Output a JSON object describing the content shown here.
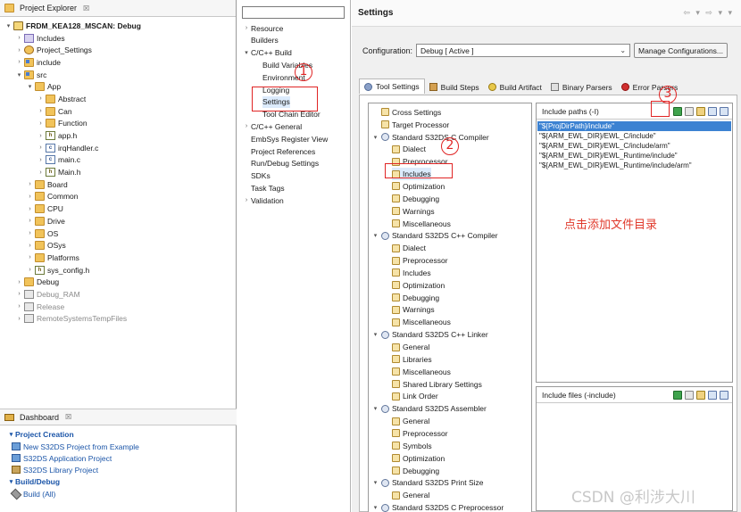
{
  "project_explorer": {
    "title": "Project Explorer",
    "close_glyph": "☒",
    "items": [
      {
        "depth": 0,
        "twisty": "▾",
        "icon": "project-icon",
        "label": "FRDM_KEA128_MSCAN: Debug",
        "bold": true
      },
      {
        "depth": 1,
        "twisty": "›",
        "icon": "includes-icon",
        "label": "Includes"
      },
      {
        "depth": 1,
        "twisty": "›",
        "icon": "settings-folder-icon",
        "label": "Project_Settings"
      },
      {
        "depth": 1,
        "twisty": "›",
        "icon": "source-folder-icon",
        "label": "include"
      },
      {
        "depth": 1,
        "twisty": "▾",
        "icon": "source-folder-icon",
        "label": "src"
      },
      {
        "depth": 2,
        "twisty": "▾",
        "icon": "folder-icon",
        "label": "App"
      },
      {
        "depth": 3,
        "twisty": "›",
        "icon": "folder-icon",
        "label": "Abstract"
      },
      {
        "depth": 3,
        "twisty": "›",
        "icon": "folder-icon",
        "label": "Can"
      },
      {
        "depth": 3,
        "twisty": "›",
        "icon": "folder-icon",
        "label": "Function"
      },
      {
        "depth": 3,
        "twisty": "›",
        "icon": "header-file-icon",
        "label": "app.h"
      },
      {
        "depth": 3,
        "twisty": "›",
        "icon": "c-file-icon",
        "label": "irqHandler.c"
      },
      {
        "depth": 3,
        "twisty": "›",
        "icon": "c-file-icon",
        "label": "main.c"
      },
      {
        "depth": 3,
        "twisty": "›",
        "icon": "header-file-icon",
        "label": "Main.h"
      },
      {
        "depth": 2,
        "twisty": "›",
        "icon": "folder-icon",
        "label": "Board"
      },
      {
        "depth": 2,
        "twisty": "›",
        "icon": "folder-icon",
        "label": "Common"
      },
      {
        "depth": 2,
        "twisty": "›",
        "icon": "folder-icon",
        "label": "CPU"
      },
      {
        "depth": 2,
        "twisty": "›",
        "icon": "folder-icon",
        "label": "Drive"
      },
      {
        "depth": 2,
        "twisty": "›",
        "icon": "folder-icon",
        "label": "OS"
      },
      {
        "depth": 2,
        "twisty": "›",
        "icon": "folder-icon",
        "label": "OSys"
      },
      {
        "depth": 2,
        "twisty": "›",
        "icon": "folder-icon",
        "label": "Platforms"
      },
      {
        "depth": 2,
        "twisty": "›",
        "icon": "header-file-icon",
        "label": "sys_config.h"
      },
      {
        "depth": 1,
        "twisty": "›",
        "icon": "folder-icon",
        "label": "Debug"
      },
      {
        "depth": 1,
        "twisty": "›",
        "icon": "binary-folder-icon",
        "label": "Debug_RAM",
        "grey": true
      },
      {
        "depth": 1,
        "twisty": "›",
        "icon": "binary-folder-icon",
        "label": "Release",
        "grey": true
      },
      {
        "depth": 1,
        "twisty": "›",
        "icon": "binary-folder-icon",
        "label": "RemoteSystemsTempFiles",
        "grey": true
      }
    ]
  },
  "dashboard": {
    "title": "Dashboard",
    "close_glyph": "☒",
    "sections": [
      {
        "title": "Project Creation",
        "items": [
          "New S32DS Project from Example",
          "S32DS Application Project",
          "S32DS Library Project"
        ]
      },
      {
        "title": "Build/Debug",
        "items": [
          "Build  (All)"
        ]
      }
    ]
  },
  "property_nav": {
    "filter_placeholder": "",
    "items": [
      {
        "depth": 0,
        "twisty": "›",
        "label": "Resource"
      },
      {
        "depth": 0,
        "twisty": "",
        "label": "Builders"
      },
      {
        "depth": 0,
        "twisty": "▾",
        "label": "C/C++ Build"
      },
      {
        "depth": 1,
        "twisty": "",
        "label": "Build Variables"
      },
      {
        "depth": 1,
        "twisty": "",
        "label": "Environment"
      },
      {
        "depth": 1,
        "twisty": "",
        "label": "Logging"
      },
      {
        "depth": 1,
        "twisty": "",
        "label": "Settings",
        "selected": true
      },
      {
        "depth": 1,
        "twisty": "",
        "label": "Tool Chain Editor"
      },
      {
        "depth": 0,
        "twisty": "›",
        "label": "C/C++ General"
      },
      {
        "depth": 0,
        "twisty": "",
        "label": "EmbSys Register View"
      },
      {
        "depth": 0,
        "twisty": "",
        "label": "Project References"
      },
      {
        "depth": 0,
        "twisty": "",
        "label": "Run/Debug Settings"
      },
      {
        "depth": 0,
        "twisty": "",
        "label": "SDKs"
      },
      {
        "depth": 0,
        "twisty": "",
        "label": "Task Tags"
      },
      {
        "depth": 0,
        "twisty": "›",
        "label": "Validation"
      }
    ]
  },
  "settings": {
    "title": "Settings",
    "nav_arrows": "⇦ ▾ ⇨ ▾ ▾",
    "configuration_label": "Configuration:",
    "configuration_value": "Debug  [ Active ]",
    "manage_button": "Manage Configurations...",
    "tabs": [
      {
        "label": "Tool Settings",
        "icon": "tool-settings-icon",
        "active": true
      },
      {
        "label": "Build Steps",
        "icon": "build-steps-icon"
      },
      {
        "label": "Build Artifact",
        "icon": "build-artifact-icon"
      },
      {
        "label": "Binary Parsers",
        "icon": "binary-parsers-icon"
      },
      {
        "label": "Error Parsers",
        "icon": "error-parsers-icon"
      }
    ],
    "tool_tree": [
      {
        "depth": 0,
        "twisty": "",
        "icon": "option-icon",
        "label": "Cross Settings"
      },
      {
        "depth": 0,
        "twisty": "",
        "icon": "option-icon",
        "label": "Target Processor"
      },
      {
        "depth": 0,
        "twisty": "▾",
        "icon": "tool-icon",
        "label": "Standard S32DS C Compiler"
      },
      {
        "depth": 1,
        "twisty": "",
        "icon": "option-icon",
        "label": "Dialect"
      },
      {
        "depth": 1,
        "twisty": "",
        "icon": "option-icon",
        "label": "Preprocessor"
      },
      {
        "depth": 1,
        "twisty": "",
        "icon": "option-icon",
        "label": "Includes",
        "selected": true
      },
      {
        "depth": 1,
        "twisty": "",
        "icon": "option-icon",
        "label": "Optimization"
      },
      {
        "depth": 1,
        "twisty": "",
        "icon": "option-icon",
        "label": "Debugging"
      },
      {
        "depth": 1,
        "twisty": "",
        "icon": "option-icon",
        "label": "Warnings"
      },
      {
        "depth": 1,
        "twisty": "",
        "icon": "option-icon",
        "label": "Miscellaneous"
      },
      {
        "depth": 0,
        "twisty": "▾",
        "icon": "tool-icon",
        "label": "Standard S32DS C++ Compiler"
      },
      {
        "depth": 1,
        "twisty": "",
        "icon": "option-icon",
        "label": "Dialect"
      },
      {
        "depth": 1,
        "twisty": "",
        "icon": "option-icon",
        "label": "Preprocessor"
      },
      {
        "depth": 1,
        "twisty": "",
        "icon": "option-icon",
        "label": "Includes"
      },
      {
        "depth": 1,
        "twisty": "",
        "icon": "option-icon",
        "label": "Optimization"
      },
      {
        "depth": 1,
        "twisty": "",
        "icon": "option-icon",
        "label": "Debugging"
      },
      {
        "depth": 1,
        "twisty": "",
        "icon": "option-icon",
        "label": "Warnings"
      },
      {
        "depth": 1,
        "twisty": "",
        "icon": "option-icon",
        "label": "Miscellaneous"
      },
      {
        "depth": 0,
        "twisty": "▾",
        "icon": "tool-icon",
        "label": "Standard S32DS C++ Linker"
      },
      {
        "depth": 1,
        "twisty": "",
        "icon": "option-icon",
        "label": "General"
      },
      {
        "depth": 1,
        "twisty": "",
        "icon": "option-icon",
        "label": "Libraries"
      },
      {
        "depth": 1,
        "twisty": "",
        "icon": "option-icon",
        "label": "Miscellaneous"
      },
      {
        "depth": 1,
        "twisty": "",
        "icon": "option-icon",
        "label": "Shared Library Settings"
      },
      {
        "depth": 1,
        "twisty": "",
        "icon": "option-icon",
        "label": "Link Order"
      },
      {
        "depth": 0,
        "twisty": "▾",
        "icon": "tool-icon",
        "label": "Standard S32DS Assembler"
      },
      {
        "depth": 1,
        "twisty": "",
        "icon": "option-icon",
        "label": "General"
      },
      {
        "depth": 1,
        "twisty": "",
        "icon": "option-icon",
        "label": "Preprocessor"
      },
      {
        "depth": 1,
        "twisty": "",
        "icon": "option-icon",
        "label": "Symbols"
      },
      {
        "depth": 1,
        "twisty": "",
        "icon": "option-icon",
        "label": "Optimization"
      },
      {
        "depth": 1,
        "twisty": "",
        "icon": "option-icon",
        "label": "Debugging"
      },
      {
        "depth": 0,
        "twisty": "▾",
        "icon": "tool-icon",
        "label": "Standard S32DS Print Size"
      },
      {
        "depth": 1,
        "twisty": "",
        "icon": "option-icon",
        "label": "General"
      },
      {
        "depth": 0,
        "twisty": "▾",
        "icon": "tool-icon",
        "label": "Standard S32DS C Preprocessor"
      }
    ],
    "include_paths": {
      "title": "Include paths (-I)",
      "items": [
        "\"${ProjDirPath}/include\"",
        "\"${ARM_EWL_DIR}/EWL_C/include\"",
        "\"${ARM_EWL_DIR}/EWL_C/include/arm\"",
        "\"${ARM_EWL_DIR}/EWL_Runtime/include\"",
        "\"${ARM_EWL_DIR}/EWL_Runtime/include/arm\""
      ]
    },
    "include_files": {
      "title": "Include files (-include)",
      "items": []
    }
  },
  "annotations": {
    "step1": "1",
    "step2": "2",
    "step3": "3",
    "note": "点击添加文件目录",
    "watermark": "CSDN @利涉大川",
    "color": "#e02424"
  }
}
